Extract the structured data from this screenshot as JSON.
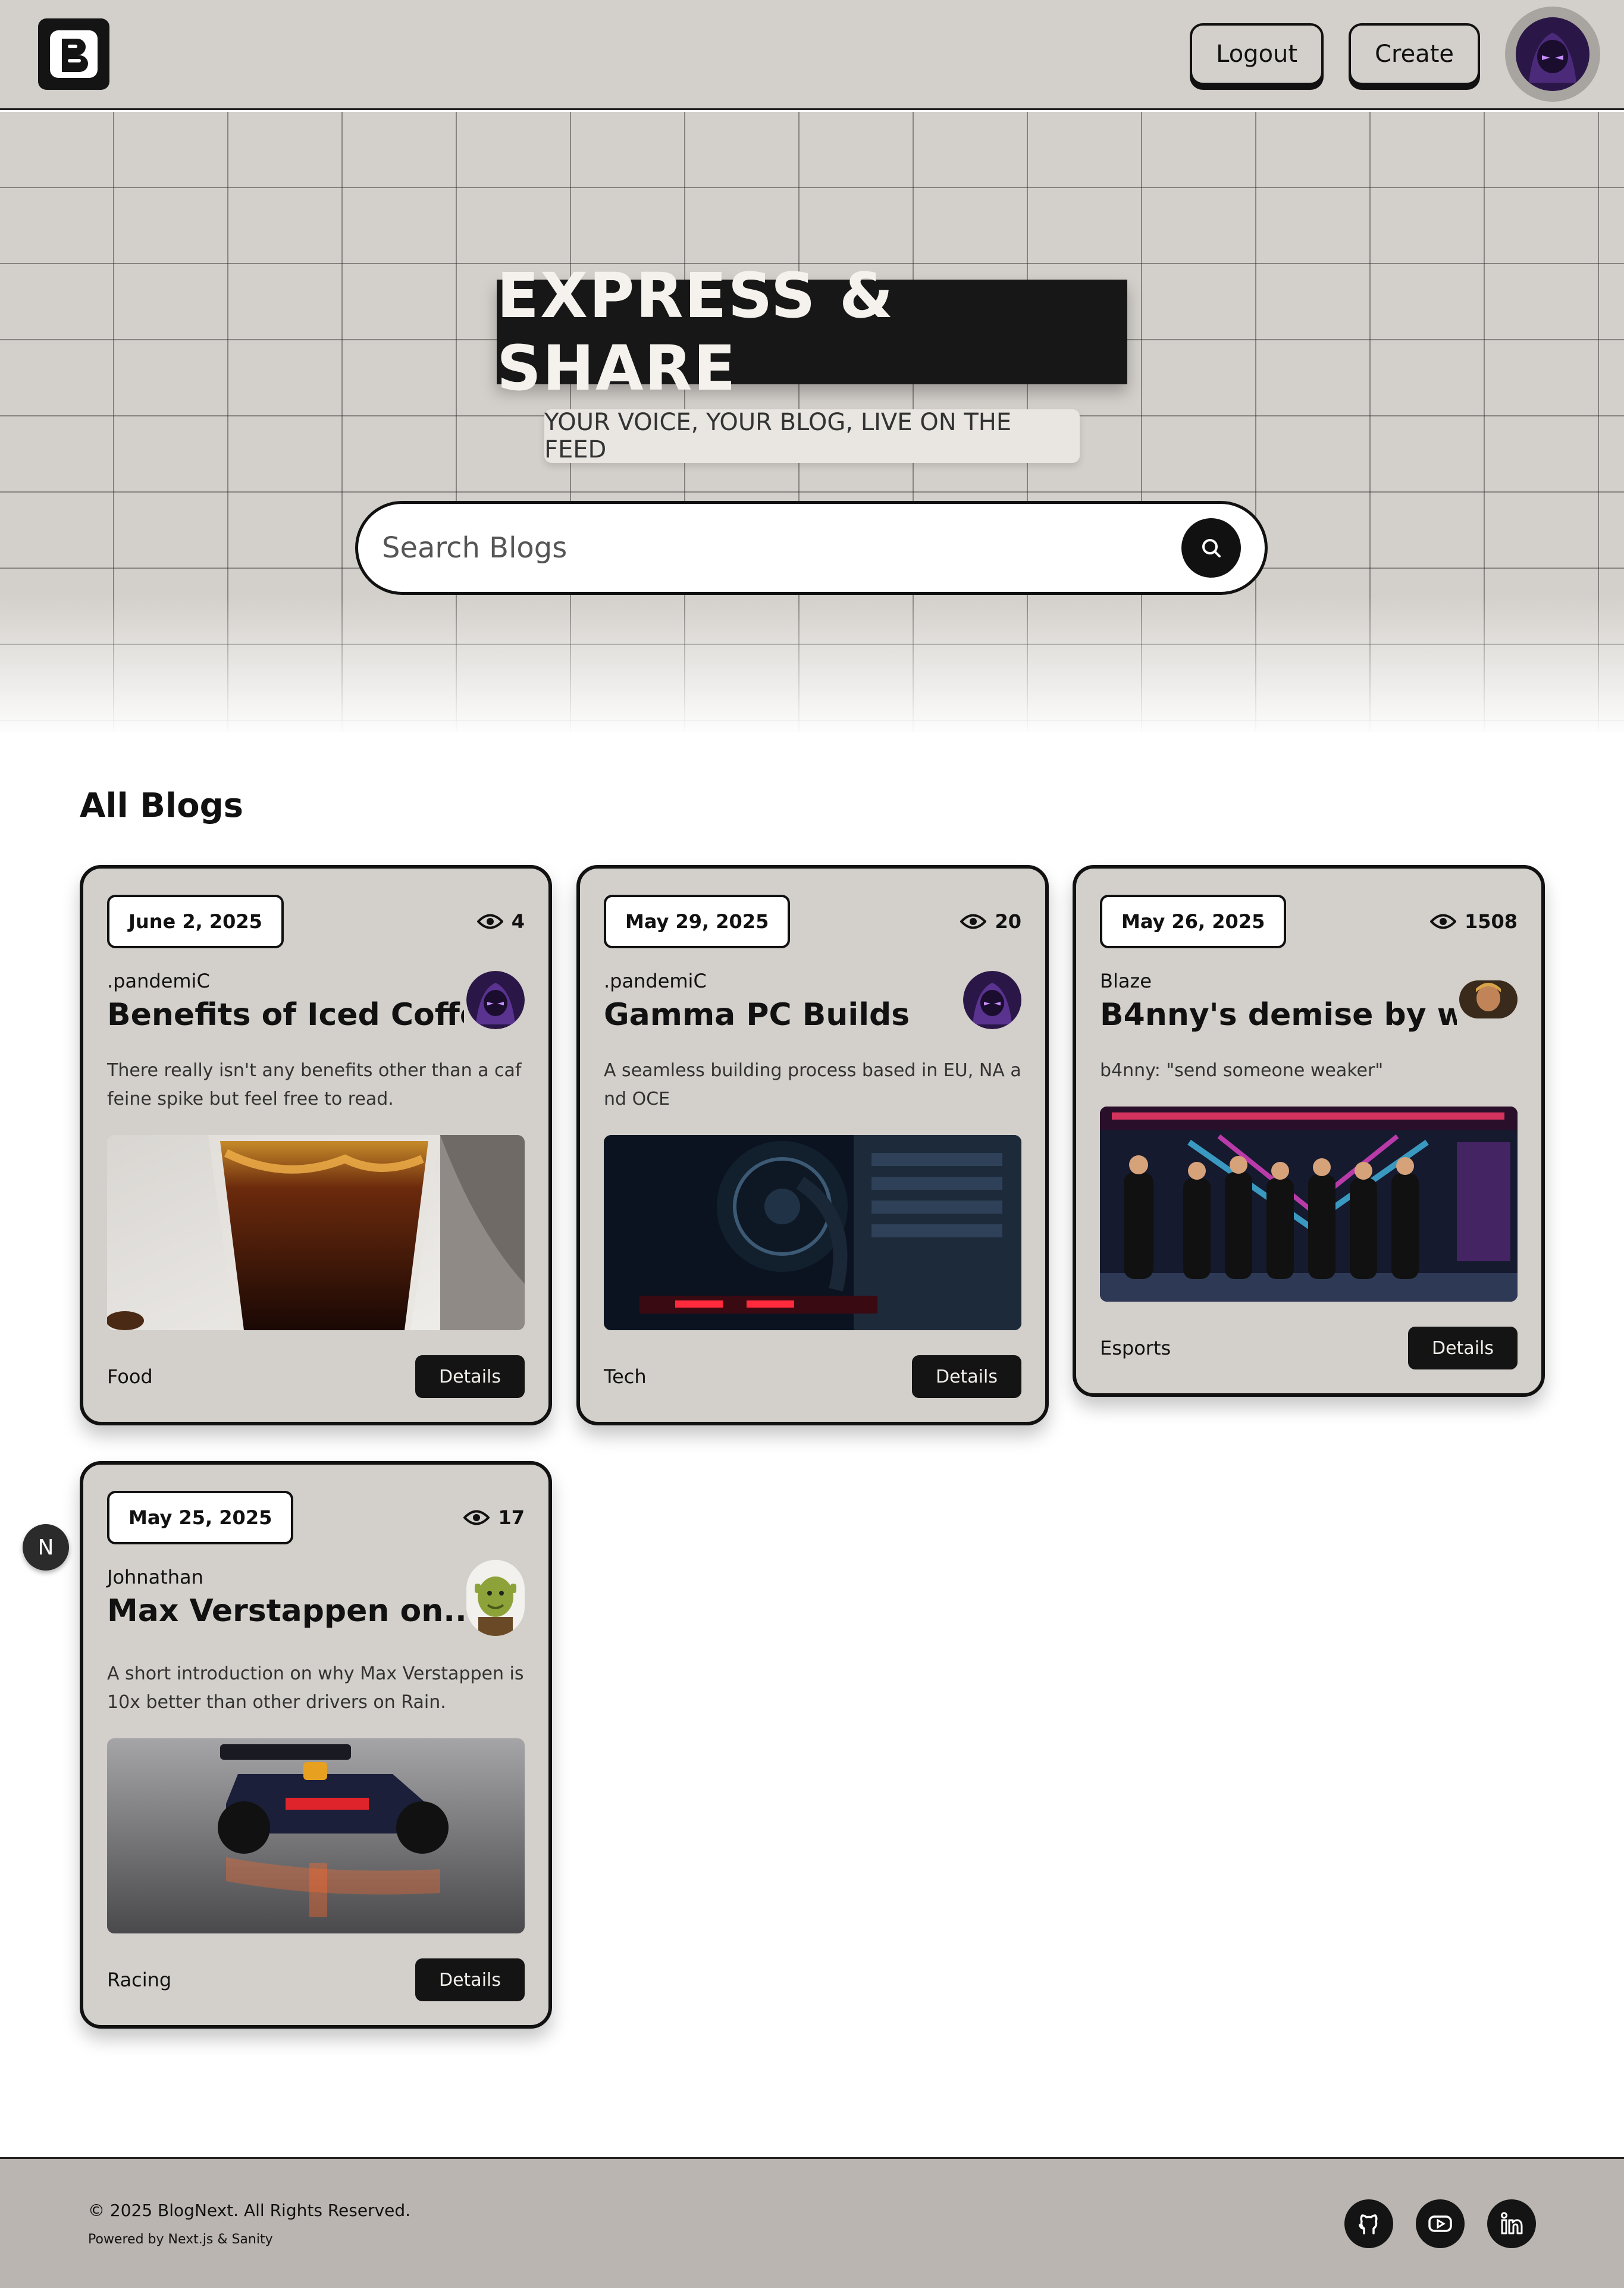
{
  "header": {
    "logo_letter": "B",
    "logout_label": "Logout",
    "create_label": "Create"
  },
  "hero": {
    "title": "EXPRESS & SHARE",
    "subtitle": "YOUR VOICE, YOUR BLOG, LIVE ON THE FEED",
    "search_placeholder": "Search Blogs"
  },
  "section_title": "All Blogs",
  "cards": [
    {
      "date": "June 2, 2025",
      "views": "4",
      "author": ".pandemiC",
      "title": "Benefits of Iced Coffee",
      "description": "There really isn't any benefits other than a caffeine spike but feel free to read.",
      "category": "Food",
      "details_label": "Details",
      "image": "iced-coffee-photo",
      "avatar": "purple-hooded-avatar"
    },
    {
      "date": "May 29, 2025",
      "views": "20",
      "author": ".pandemiC",
      "title": "Gamma PC Builds",
      "description": "A seamless building process based in EU, NA and OCE",
      "category": "Tech",
      "details_label": "Details",
      "image": "pc-build-photo",
      "avatar": "purple-hooded-avatar"
    },
    {
      "date": "May 26, 2025",
      "views": "1508",
      "author": "Blaze",
      "title": "B4nny's demise by w...",
      "description": "b4nny: \"send someone weaker\"",
      "category": "Esports",
      "details_label": "Details",
      "image": "esports-team-stage-photo",
      "avatar": "blaze-avatar"
    },
    {
      "date": "May 25, 2025",
      "views": "17",
      "author": "Johnathan",
      "title": "Max Verstappen on...",
      "description": "A short introduction on why Max Verstappen is 10x better than other drivers on Rain.",
      "category": "Racing",
      "details_label": "Details",
      "image": "f1-car-rain-photo",
      "avatar": "shrek-avatar"
    }
  ],
  "n_badge": "N",
  "footer": {
    "copyright": "© 2025 BlogNext. All Rights Reserved.",
    "powered": "Powered by Next.js & Sanity"
  },
  "colors": {
    "header_bg": "#d3cfca",
    "card_bg": "#d3cfca",
    "footer_bg": "#bab5b0",
    "dark": "#141414"
  }
}
